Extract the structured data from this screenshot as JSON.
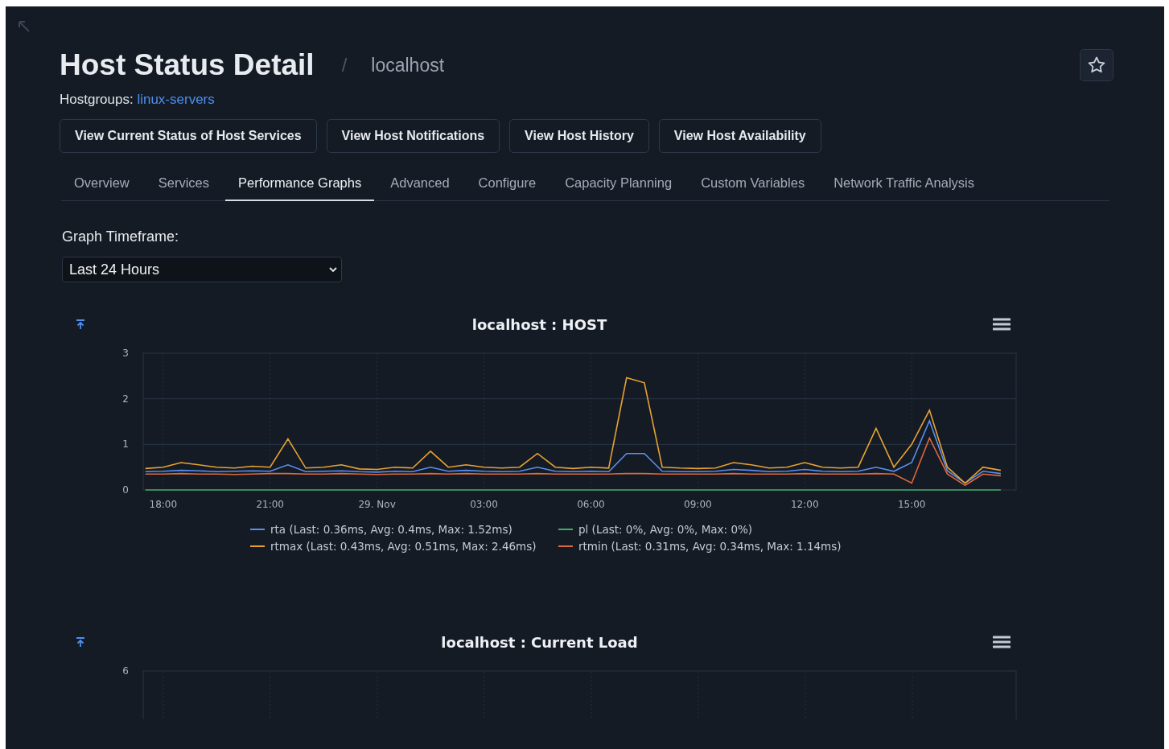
{
  "header": {
    "title": "Host Status Detail",
    "separator": "/",
    "subtitle": "localhost"
  },
  "hostgroups": {
    "label": "Hostgroups:",
    "link": "linux-servers"
  },
  "actions": [
    "View Current Status of Host Services",
    "View Host Notifications",
    "View Host History",
    "View Host Availability"
  ],
  "tabs": [
    {
      "label": "Overview",
      "selected": false
    },
    {
      "label": "Services",
      "selected": false
    },
    {
      "label": "Performance Graphs",
      "selected": true
    },
    {
      "label": "Advanced",
      "selected": false
    },
    {
      "label": "Configure",
      "selected": false
    },
    {
      "label": "Capacity Planning",
      "selected": false
    },
    {
      "label": "Custom Variables",
      "selected": false
    },
    {
      "label": "Network Traffic Analysis",
      "selected": false
    }
  ],
  "timeframe": {
    "label": "Graph Timeframe:",
    "value": "Last 24 Hours"
  },
  "graphs": [
    {
      "kind": "chart",
      "legend_stats": [
        "(Last: 0.36ms, Avg: 0.4ms, Max: 1.52ms)",
        "(Last: 0%, Avg: 0%, Max: 0%)",
        "(Last: 0.43ms, Avg: 0.51ms, Max: 2.46ms)",
        "(Last: 0.31ms, Avg: 0.34ms, Max: 1.14ms)"
      ],
      "chart_data": {
        "type": "line",
        "title": "localhost : HOST",
        "grid": true,
        "categories": [
          null,
          "18:00",
          null,
          null,
          null,
          null,
          null,
          "21:00",
          null,
          null,
          null,
          null,
          null,
          "29. Nov",
          null,
          null,
          null,
          null,
          null,
          "03:00",
          null,
          null,
          null,
          null,
          null,
          "06:00",
          null,
          null,
          null,
          null,
          null,
          "09:00",
          null,
          null,
          null,
          null,
          null,
          "12:00",
          null,
          null,
          null,
          null,
          null,
          "15:00",
          null,
          null,
          null,
          null,
          null
        ],
        "ylim": [
          0,
          3
        ],
        "yticks": [
          0,
          1,
          2,
          3
        ],
        "series": [
          {
            "name": "rta",
            "color": "#5b8ff0",
            "values": [
              0.4,
              0.41,
              0.43,
              0.42,
              0.4,
              0.41,
              0.42,
              0.41,
              0.55,
              0.4,
              0.41,
              0.42,
              0.4,
              0.39,
              0.41,
              0.4,
              0.5,
              0.41,
              0.43,
              0.41,
              0.4,
              0.41,
              0.5,
              0.41,
              0.4,
              0.41,
              0.4,
              0.8,
              0.8,
              0.41,
              0.4,
              0.4,
              0.41,
              0.45,
              0.43,
              0.4,
              0.41,
              0.45,
              0.41,
              0.4,
              0.41,
              0.5,
              0.41,
              0.6,
              1.52,
              0.42,
              0.15,
              0.41,
              0.36
            ]
          },
          {
            "name": "pl",
            "color": "#3fae6a",
            "values": [
              0,
              0,
              0,
              0,
              0,
              0,
              0,
              0,
              0,
              0,
              0,
              0,
              0,
              0,
              0,
              0,
              0,
              0,
              0,
              0,
              0,
              0,
              0,
              0,
              0,
              0,
              0,
              0,
              0,
              0,
              0,
              0,
              0,
              0,
              0,
              0,
              0,
              0,
              0,
              0,
              0,
              0,
              0,
              0,
              0,
              0,
              0,
              0,
              0
            ]
          },
          {
            "name": "rtmax",
            "color": "#e8a232",
            "values": [
              0.47,
              0.5,
              0.6,
              0.55,
              0.5,
              0.48,
              0.52,
              0.5,
              1.12,
              0.48,
              0.5,
              0.55,
              0.46,
              0.45,
              0.5,
              0.48,
              0.85,
              0.5,
              0.55,
              0.5,
              0.48,
              0.5,
              0.8,
              0.5,
              0.47,
              0.5,
              0.48,
              2.46,
              2.35,
              0.5,
              0.48,
              0.47,
              0.48,
              0.6,
              0.55,
              0.48,
              0.5,
              0.6,
              0.5,
              0.48,
              0.5,
              1.35,
              0.5,
              1.0,
              1.75,
              0.5,
              0.15,
              0.5,
              0.43
            ]
          },
          {
            "name": "rtmin",
            "color": "#e0683a",
            "values": [
              0.35,
              0.35,
              0.36,
              0.35,
              0.35,
              0.34,
              0.35,
              0.36,
              0.36,
              0.35,
              0.35,
              0.36,
              0.35,
              0.34,
              0.35,
              0.35,
              0.36,
              0.35,
              0.36,
              0.35,
              0.35,
              0.35,
              0.36,
              0.35,
              0.35,
              0.35,
              0.35,
              0.36,
              0.36,
              0.35,
              0.35,
              0.35,
              0.35,
              0.36,
              0.35,
              0.35,
              0.35,
              0.36,
              0.35,
              0.35,
              0.35,
              0.36,
              0.35,
              0.15,
              1.14,
              0.35,
              0.1,
              0.35,
              0.31
            ]
          }
        ]
      }
    },
    {
      "kind": "partial",
      "title": "localhost : Current Load",
      "y_tick_labels": [
        "6"
      ]
    }
  ]
}
